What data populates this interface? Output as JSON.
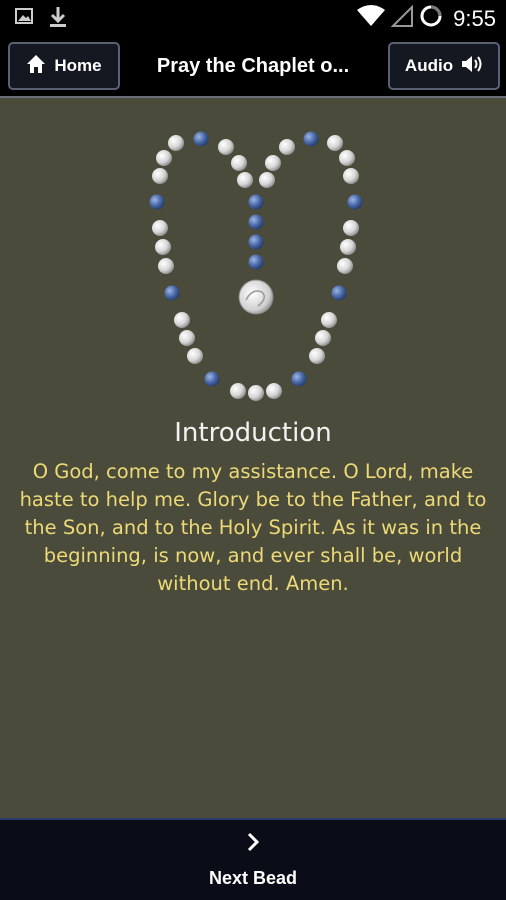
{
  "status_bar": {
    "time": "9:55",
    "icons": [
      "image-notification-icon",
      "download-icon",
      "wifi-icon",
      "signal-icon",
      "battery-icon"
    ]
  },
  "header": {
    "home_label": "Home",
    "title": "Pray the Chaplet o...",
    "audio_label": "Audio"
  },
  "section": {
    "title": "Introduction",
    "text": "O God, come to my assistance. O Lord, make haste to help me. Glory be to the Father, and to the Son, and to the Holy Spirit. As it was in the beginning, is now, and ever shall be, world without end. Amen."
  },
  "footer": {
    "next_label": "Next Bead"
  },
  "colors": {
    "background": "#4b4b3b",
    "prayer_text": "#ecd977",
    "bead_blue": "#4a6aa8",
    "bead_white": "#e8e8e8"
  }
}
